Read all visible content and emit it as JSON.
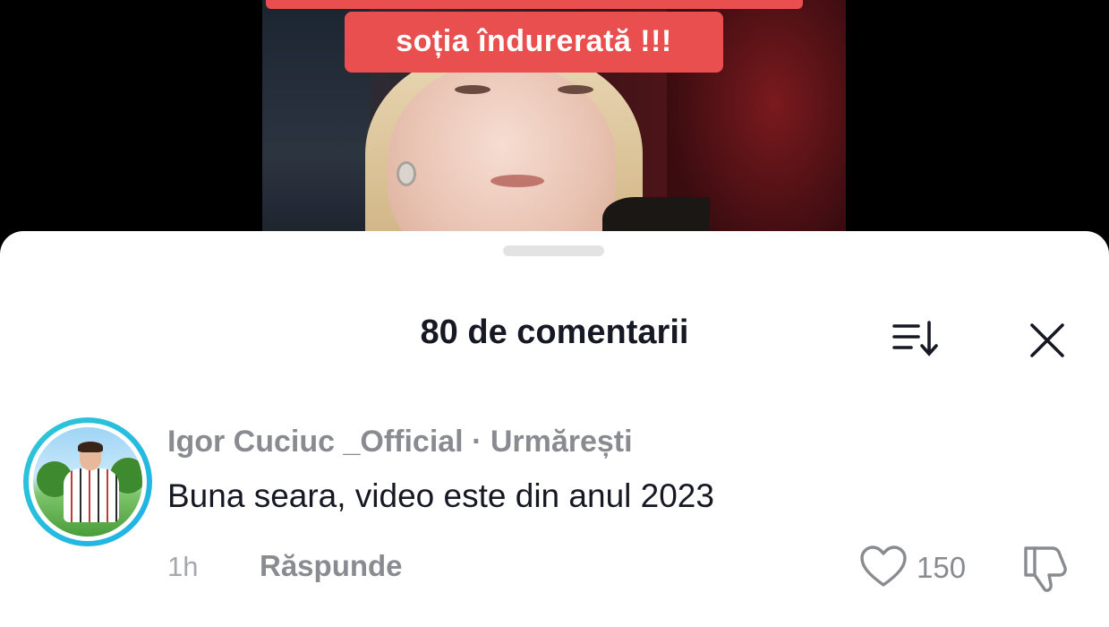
{
  "video": {
    "banner_text": "soția îndurerată !!!"
  },
  "comments_sheet": {
    "title": "80 de comentarii",
    "sort_icon": "sort-icon",
    "close_icon": "close-icon",
    "comments": [
      {
        "author": "Igor Cuciuc _Official · Urmărești",
        "text": "Buna seara, video este din anul 2023",
        "time": "1h",
        "reply_label": "Răspunde",
        "likes": "150",
        "like_icon": "heart-icon",
        "dislike_icon": "dislike-icon"
      }
    ]
  },
  "colors": {
    "banner": "#ea4f4f",
    "avatar_ring": "#2ec7d6",
    "text_primary": "#161823",
    "text_secondary": "#8a8b91"
  }
}
